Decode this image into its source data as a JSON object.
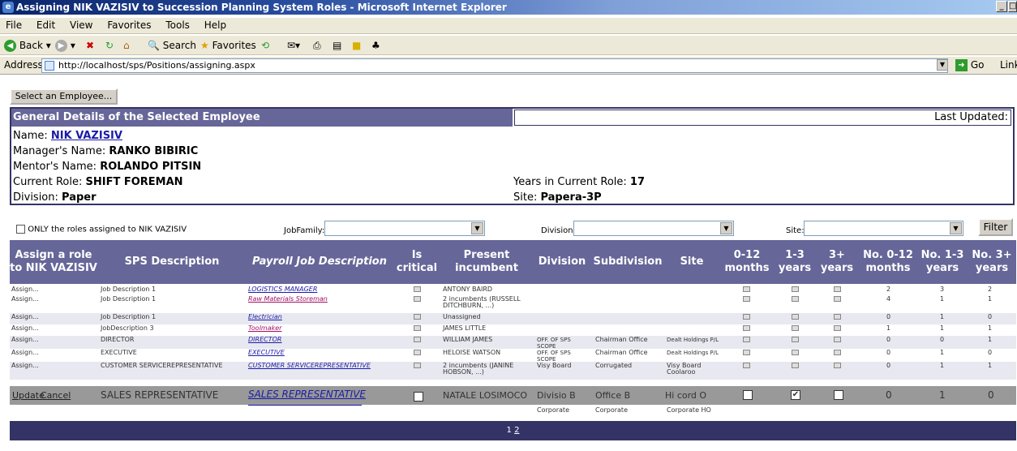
{
  "window": {
    "title": "Assigning NIK VAZISIV  to Succession Planning System Roles - Microsoft Internet Explorer"
  },
  "menu": [
    "File",
    "Edit",
    "View",
    "Favorites",
    "Tools",
    "Help"
  ],
  "toolbar": {
    "back": "Back",
    "search": "Search",
    "favorites": "Favorites"
  },
  "address": {
    "label": "Address",
    "url": "http://localhost/sps/Positions/assigning.aspx",
    "go": "Go",
    "links": "Link"
  },
  "select_employee_button": "Select an Employee...",
  "details": {
    "header": "General Details of the Selected Employee",
    "last_updated_label": "Last Updated:",
    "name_label": "Name:",
    "name": "NIK VAZISIV",
    "manager_label": "Manager's Name:",
    "manager": "RANKO BIBIRIC",
    "mentor_label": "Mentor's Name:",
    "mentor": "ROLANDO PITSIN",
    "role_label": "Current Role:",
    "role": "SHIFT FOREMAN",
    "years_label": "Years in Current Role:",
    "years": "17",
    "division_label": "Division:",
    "division": "Paper",
    "site_label": "Site:",
    "site": "Papera-3P"
  },
  "filters": {
    "only_roles_label": "ONLY the roles assigned to NIK VAZISIV",
    "jobfamily_label": "JobFamily:",
    "division_label": "Division:",
    "site_label": "Site:",
    "filter_button": "Filter"
  },
  "grid": {
    "headers": {
      "assign": "Assign a role to NIK VAZISIV",
      "sps": "SPS Description",
      "payroll": "Payroll Job Description",
      "critical": "Is critical",
      "incumbent": "Present incumbent",
      "division": "Division",
      "subdivision": "Subdivision",
      "site": "Site",
      "m012": "0-12 months",
      "y13": "1-3 years",
      "y3p": "3+ years",
      "n012": "No. 0-12 months",
      "n13": "No. 1-3 years",
      "n3p": "No. 3+ years"
    },
    "rows": [
      {
        "assign": "Assign...",
        "sps": "Job Description 1",
        "payroll": "LOGISTICS MANAGER",
        "incumbent": "ANTONY BAIRD",
        "division": "",
        "subdivision": "",
        "site": "",
        "n012": "2",
        "n13": "3",
        "n3p": "2"
      },
      {
        "assign": "Assign...",
        "sps": "Job Description 1",
        "payroll": "Raw Materials Storeman",
        "incumbent": "2 incumbents (RUSSELL DITCHBURN, ...)",
        "division": "",
        "subdivision": "",
        "site": "",
        "n012": "4",
        "n13": "1",
        "n3p": "1"
      },
      {
        "assign": "Assign...",
        "sps": "Job Description 1",
        "payroll": "Electrician",
        "incumbent": "Unassigned",
        "division": "",
        "subdivision": "",
        "site": "",
        "n012": "0",
        "n13": "1",
        "n3p": "0"
      },
      {
        "assign": "Assign...",
        "sps": "JobDescription 3",
        "payroll": "Toolmaker",
        "incumbent": "JAMES LITTLE",
        "division": "",
        "subdivision": "",
        "site": "",
        "n012": "1",
        "n13": "1",
        "n3p": "1"
      },
      {
        "assign": "Assign...",
        "sps": "DIRECTOR",
        "payroll": "DIRECTOR",
        "incumbent": "WILLIAM JAMES",
        "division": "OFF. OF SPS SCOPE",
        "subdivision": "Chairman Office",
        "site": "Dealt Holdings P/L",
        "n012": "0",
        "n13": "0",
        "n3p": "1"
      },
      {
        "assign": "Assign...",
        "sps": "EXECUTIVE",
        "payroll": "EXECUTIVE",
        "incumbent": "HELOISE WATSON",
        "division": "OFF. OF SPS SCOPE",
        "subdivision": "Chairman Office",
        "site": "Dealt Holdings P/L",
        "n012": "0",
        "n13": "1",
        "n3p": "0"
      },
      {
        "assign": "Assign...",
        "sps": "CUSTOMER SERVICEREPRESENTATIVE",
        "payroll": "CUSTOMER SERVICEREPRESENTATIVE",
        "incumbent": "2 incumbents (JANINE HOBSON, ...)",
        "division": "Visy Board",
        "subdivision": "Corrugated",
        "site": "Visy Board Coolaroo",
        "n012": "0",
        "n13": "1",
        "n3p": "1"
      }
    ],
    "edit_row": {
      "update": "Update",
      "cancel": "Cancel",
      "sps": "SALES REPRESENTATIVE",
      "payroll": "SALES REPRESENTATIVE",
      "incumbent": "NATALE LOSIMOCO",
      "division": "Divisio B",
      "subdivision": "Office B",
      "site": "Hi cord O",
      "n012": "0",
      "n13": "1",
      "n3p": "0"
    },
    "last_row": {
      "division": "Corporate",
      "subdivision": "Corporate",
      "site": "Corporate HO"
    }
  },
  "pager": {
    "page1": "1",
    "page2": "2"
  }
}
